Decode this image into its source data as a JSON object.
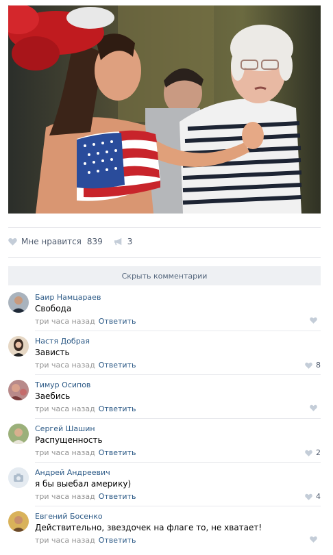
{
  "post": {
    "likes_label": "Мне нравится",
    "likes_count": "839",
    "shares_count": "3"
  },
  "hide_comments_label": "Скрыть комментарии",
  "comments": [
    {
      "author": "Баир Намцараев",
      "text": "Свобода",
      "time": "три часа назад",
      "reply": "Ответить",
      "likes": ""
    },
    {
      "author": "Настя Добрая",
      "text": "Зависть",
      "time": "три часа назад",
      "reply": "Ответить",
      "likes": "8"
    },
    {
      "author": "Тимур Осипов",
      "text": "Заебись",
      "time": "три часа назад",
      "reply": "Ответить",
      "likes": ""
    },
    {
      "author": "Сергей Шашин",
      "text": "Распущенность",
      "time": "три часа назад",
      "reply": "Ответить",
      "likes": "2"
    },
    {
      "author": "Андрей Андреевич",
      "text": "я бы выебал америку)",
      "time": "три часа назад",
      "reply": "Ответить",
      "likes": "4"
    },
    {
      "author": "Евгений Босенко",
      "text": "Действительно, звездочек на флаге то, не хватает!",
      "time": "три часа назад",
      "reply": "Ответить",
      "likes": ""
    }
  ],
  "colors": {
    "link": "#2a5885",
    "muted": "#939393",
    "icon": "#c4cdd8",
    "divider": "#e7e8ec"
  }
}
